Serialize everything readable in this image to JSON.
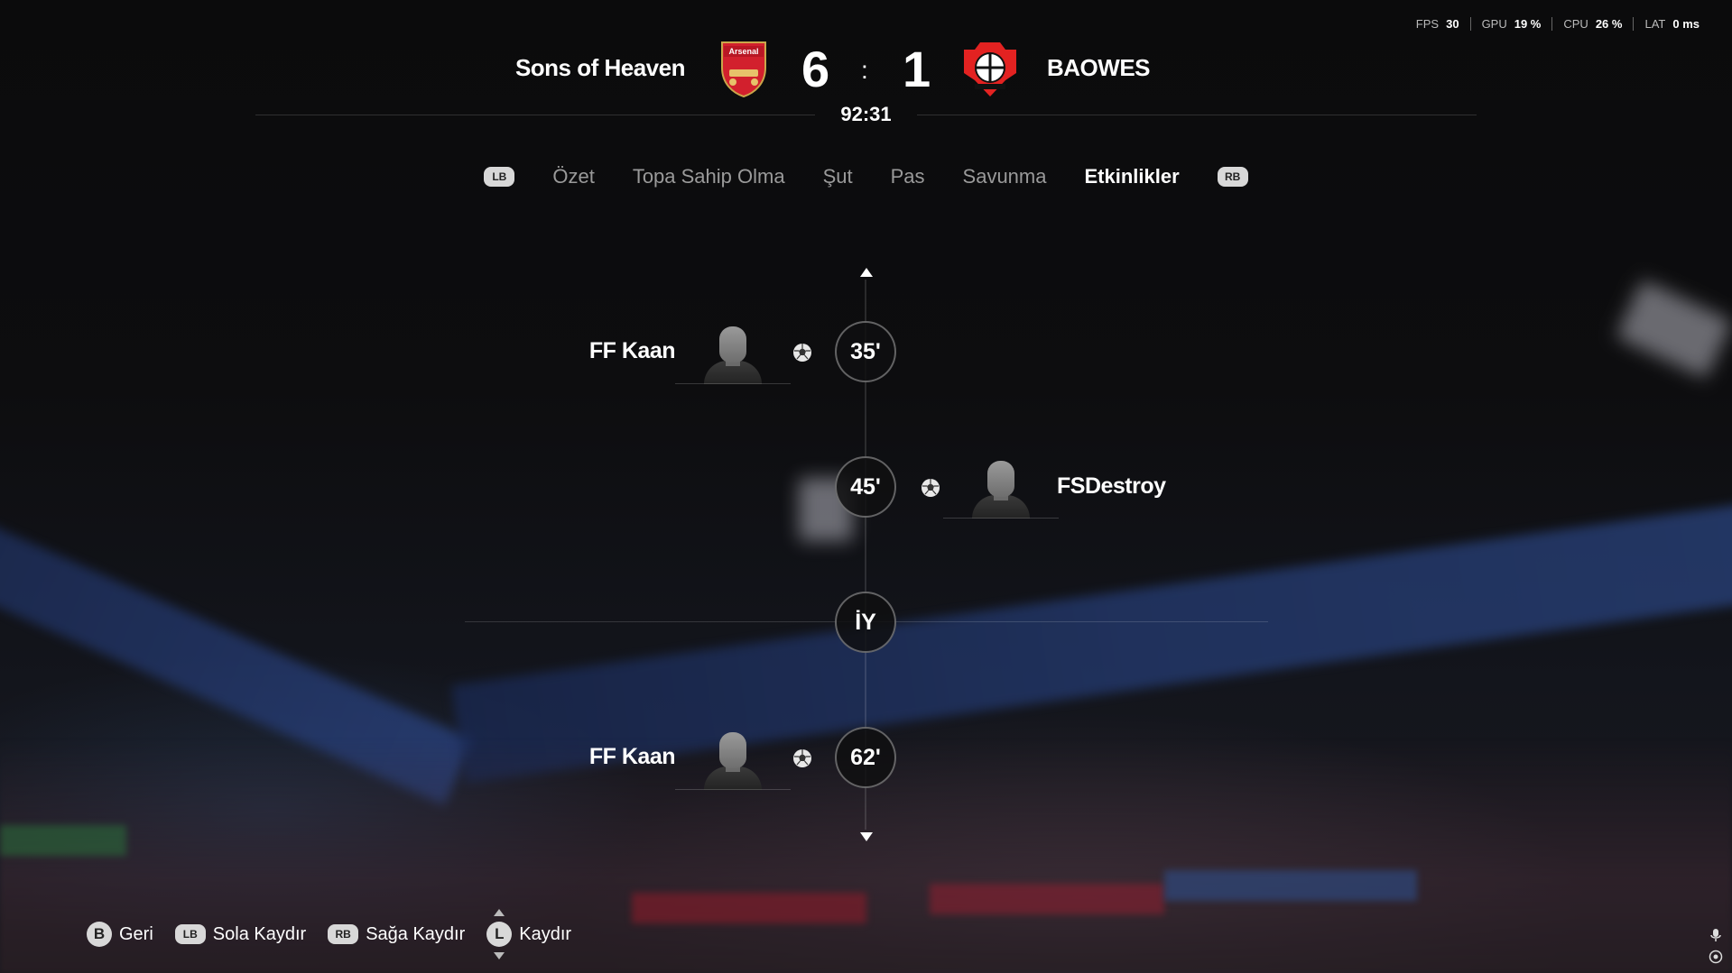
{
  "hud": {
    "fps_label": "FPS",
    "fps_value": "30",
    "gpu_label": "GPU",
    "gpu_value": "19 %",
    "cpu_label": "CPU",
    "cpu_value": "26 %",
    "lat_label": "LAT",
    "lat_value": "0 ms"
  },
  "match": {
    "home_team": "Sons of Heaven",
    "away_team": "BAOWES",
    "home_score": "6",
    "away_score": "1",
    "separator": ":",
    "clock": "92:31",
    "home_crest_icon": "arsenal-crest-icon",
    "home_crest_text": "Arsenal",
    "away_crest_icon": "leverkusen-crest-icon"
  },
  "tabs": {
    "left_bumper": "LB",
    "right_bumper": "RB",
    "items": [
      "Özet",
      "Topa Sahip Olma",
      "Şut",
      "Pas",
      "Savunma",
      "Etkinlikler"
    ],
    "active": "Etkinlikler"
  },
  "events": [
    {
      "minute": "35'",
      "player": "FF Kaan",
      "side": "home",
      "type": "goal"
    },
    {
      "minute": "45'",
      "player": "FSDestroy",
      "side": "away",
      "type": "goal"
    },
    {
      "minute": "İY",
      "type": "half-time"
    },
    {
      "minute": "62'",
      "player": "FF Kaan",
      "side": "home",
      "type": "goal"
    }
  ],
  "footer": {
    "back_btn": "B",
    "back_label": "Geri",
    "left_btn": "LB",
    "left_label": "Sola Kaydır",
    "right_btn": "RB",
    "right_label": "Sağa Kaydır",
    "scroll_btn": "L",
    "scroll_label": "Kaydır"
  }
}
